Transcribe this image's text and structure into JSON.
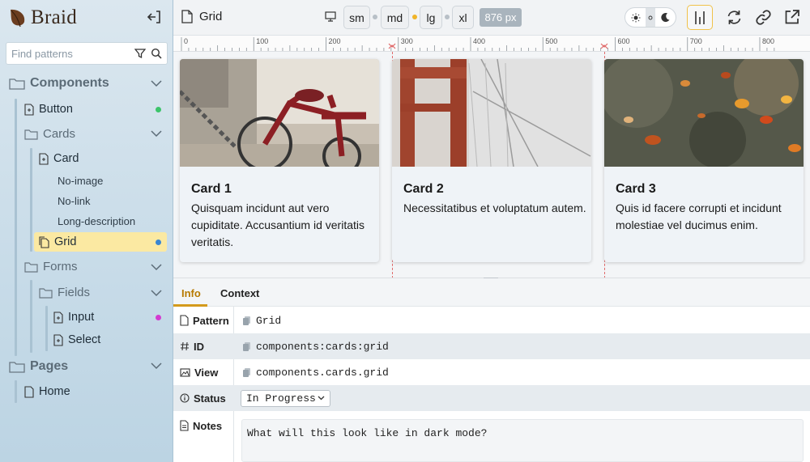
{
  "app": {
    "name": "Braid"
  },
  "sidebar": {
    "search_placeholder": "Find patterns",
    "sections": [
      {
        "label": "Components"
      },
      {
        "label": "Pages"
      }
    ],
    "items": {
      "button": "Button",
      "cards": "Cards",
      "card": "Card",
      "variants": [
        "No-image",
        "No-link",
        "Long-description"
      ],
      "grid": "Grid",
      "forms": "Forms",
      "fields": "Fields",
      "input": "Input",
      "select": "Select",
      "home": "Home"
    },
    "status_colors": {
      "button": "#3cc46a",
      "grid": "#3a86d1",
      "input": "#d43bd1"
    }
  },
  "toolbar": {
    "pattern_title": "Grid",
    "breakpoints": [
      "sm",
      "md",
      "lg",
      "xl"
    ],
    "active_breakpoint_dot": "md",
    "width_badge": "876 px"
  },
  "ruler": {
    "ticks": [
      "0",
      "100",
      "200",
      "300",
      "400",
      "500",
      "600",
      "700",
      "800"
    ]
  },
  "preview": {
    "cards": [
      {
        "title": "Card 1",
        "body": "Quisquam incidunt aut vero cupiditate. Accusantium id veritatis veritatis."
      },
      {
        "title": "Card 2",
        "body": "Necessitatibus et voluptatum autem."
      },
      {
        "title": "Card 3",
        "body": "Quis id facere corrupti et incidunt molestiae vel ducimus enim."
      }
    ]
  },
  "panel": {
    "tabs": [
      {
        "label": "Info"
      },
      {
        "label": "Context"
      }
    ],
    "rows": {
      "pattern": {
        "label": "Pattern",
        "value": "Grid"
      },
      "id": {
        "label": "ID",
        "value": "components:cards:grid"
      },
      "view": {
        "label": "View",
        "value": "components.cards.grid"
      },
      "status": {
        "label": "Status",
        "value": "In Progress"
      },
      "notes": {
        "label": "Notes",
        "value": "What will this look like in dark mode?"
      }
    }
  },
  "colors": {
    "accent": "#d49a1c",
    "selected_bg": "#fbe9a2"
  }
}
